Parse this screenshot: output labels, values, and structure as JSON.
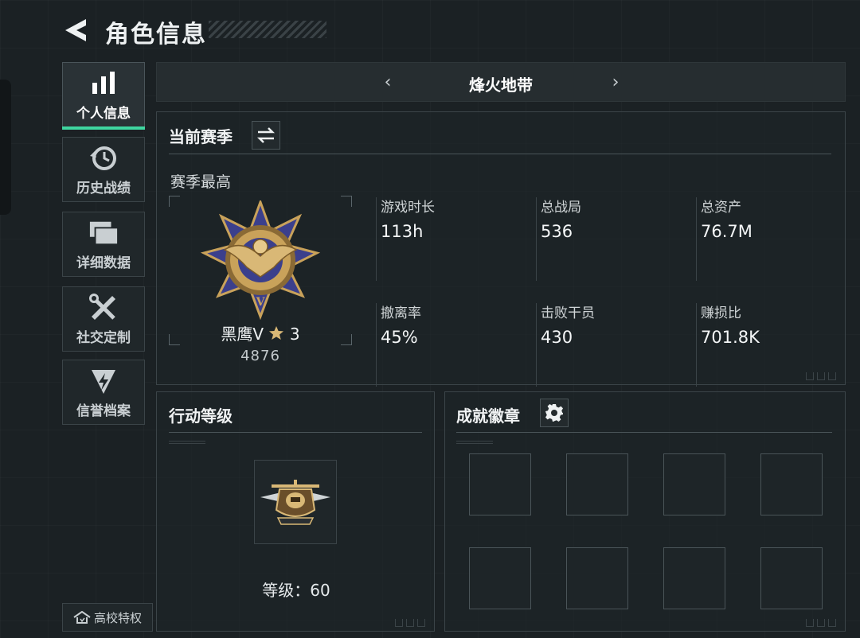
{
  "header": {
    "title": "角色信息",
    "back_icon": "back-arrow-icon"
  },
  "sidebar": {
    "items": [
      {
        "label": "个人信息",
        "icon": "bar-chart-icon",
        "active": true
      },
      {
        "label": "历史战绩",
        "icon": "history-clock-icon",
        "active": false
      },
      {
        "label": "详细数据",
        "icon": "folder-stack-icon",
        "active": false
      },
      {
        "label": "社交定制",
        "icon": "tools-icon",
        "active": false
      },
      {
        "label": "信誉档案",
        "icon": "shield-bolt-icon",
        "active": false
      }
    ],
    "campus_label": "高校特权"
  },
  "mode_bar": {
    "title": "烽火地带",
    "prev": "‹",
    "next": "›"
  },
  "season": {
    "title": "当前赛季",
    "switch_icon": "swap-arrows-icon",
    "best_label": "赛季最高",
    "rank_name": "黑鹰Ⅴ",
    "rank_stars": "3",
    "rank_score": "4876",
    "stats": [
      {
        "label": "游戏时长",
        "value": "113h"
      },
      {
        "label": "总战局",
        "value": "536"
      },
      {
        "label": "总资产",
        "value": "76.7M"
      },
      {
        "label": "撤离率",
        "value": "45%"
      },
      {
        "label": "击败干员",
        "value": "430"
      },
      {
        "label": "赚损比",
        "value": "701.8K"
      }
    ]
  },
  "action_level": {
    "title": "行动等级",
    "level_text": "等级：60"
  },
  "achievements": {
    "title": "成就徽章",
    "settings_icon": "gear-icon"
  },
  "colors": {
    "background": "#1b2124",
    "accent": "#3fd6a0",
    "medal_gold": "#c9a25a",
    "medal_blue": "#3b3f8c"
  }
}
